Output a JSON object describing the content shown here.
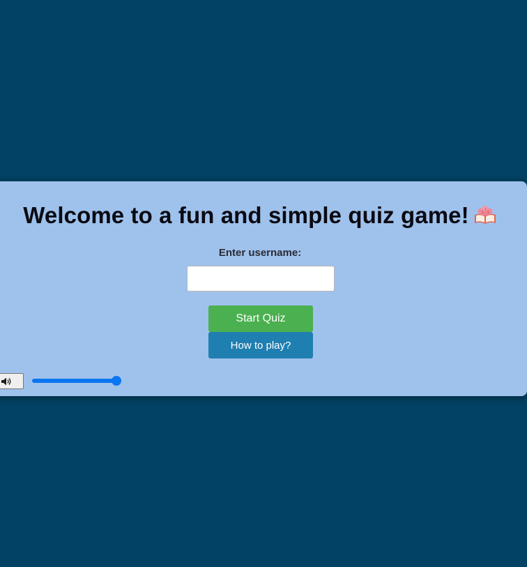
{
  "page": {
    "background_color": "#024264",
    "card_color": "#9fc2ec"
  },
  "welcome": {
    "title": "Welcome to a fun and simple quiz game!",
    "title_icon": "brain-book-emoji-icon"
  },
  "form": {
    "username_label": "Enter username:",
    "username_value": "",
    "username_placeholder": ""
  },
  "buttons": {
    "start_label": "Start Quiz",
    "start_color": "#4bb04f",
    "how_label": "How to play?",
    "how_color": "#1f7fb0"
  },
  "audio": {
    "mute_icon": "speaker-icon",
    "volume_fraction": 1.0,
    "slider_color": "#0b76f1"
  }
}
